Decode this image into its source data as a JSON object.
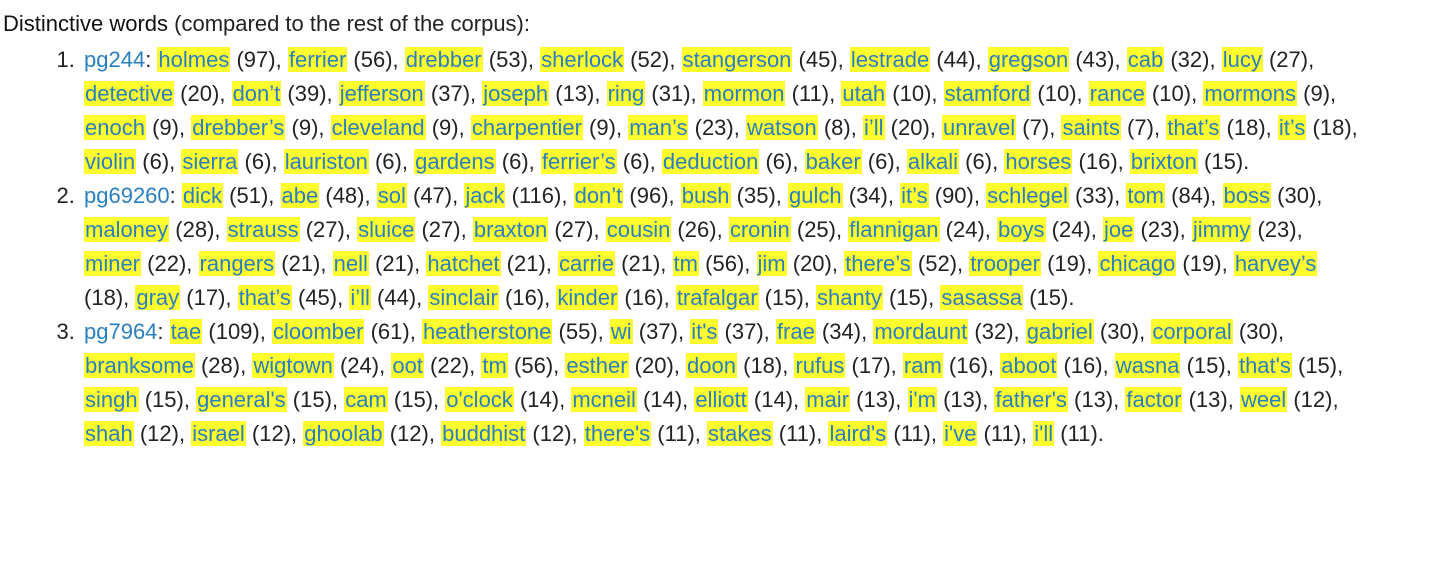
{
  "heading": {
    "main": "Distinctive words",
    "sub": " (compared to the rest of the corpus):"
  },
  "colors": {
    "highlight": "#ffff2e",
    "link": "#2a7fbf",
    "text": "#222222"
  },
  "documents": [
    {
      "id": "pg244",
      "words": [
        {
          "w": "holmes",
          "c": "97"
        },
        {
          "w": "ferrier",
          "c": "56"
        },
        {
          "w": "drebber",
          "c": "53"
        },
        {
          "w": "sherlock",
          "c": "52"
        },
        {
          "w": "stangerson",
          "c": "45"
        },
        {
          "w": "lestrade",
          "c": "44"
        },
        {
          "w": "gregson",
          "c": "43"
        },
        {
          "w": "cab",
          "c": "32"
        },
        {
          "w": "lucy",
          "c": "27"
        },
        {
          "w": "detective",
          "c": "20"
        },
        {
          "w": "don’t",
          "c": "39"
        },
        {
          "w": "jefferson",
          "c": "37"
        },
        {
          "w": "joseph",
          "c": "13"
        },
        {
          "w": "ring",
          "c": "31"
        },
        {
          "w": "mormon",
          "c": "11"
        },
        {
          "w": "utah",
          "c": "10"
        },
        {
          "w": "stamford",
          "c": "10"
        },
        {
          "w": "rance",
          "c": "10"
        },
        {
          "w": "mormons",
          "c": "9"
        },
        {
          "w": "enoch",
          "c": "9"
        },
        {
          "w": "drebber’s",
          "c": "9"
        },
        {
          "w": "cleveland",
          "c": "9"
        },
        {
          "w": "charpentier",
          "c": "9"
        },
        {
          "w": "man’s",
          "c": "23"
        },
        {
          "w": "watson",
          "c": "8"
        },
        {
          "w": "i’ll",
          "c": "20"
        },
        {
          "w": "unravel",
          "c": "7"
        },
        {
          "w": "saints",
          "c": "7"
        },
        {
          "w": "that’s",
          "c": "18"
        },
        {
          "w": "it’s",
          "c": "18"
        },
        {
          "w": "violin",
          "c": "6"
        },
        {
          "w": "sierra",
          "c": "6"
        },
        {
          "w": "lauriston",
          "c": "6"
        },
        {
          "w": "gardens",
          "c": "6"
        },
        {
          "w": "ferrier’s",
          "c": "6"
        },
        {
          "w": "deduction",
          "c": "6"
        },
        {
          "w": "baker",
          "c": "6"
        },
        {
          "w": "alkali",
          "c": "6"
        },
        {
          "w": "horses",
          "c": "16"
        },
        {
          "w": "brixton",
          "c": "15"
        }
      ]
    },
    {
      "id": "pg69260",
      "words": [
        {
          "w": "dick",
          "c": "51"
        },
        {
          "w": "abe",
          "c": "48"
        },
        {
          "w": "sol",
          "c": "47"
        },
        {
          "w": "jack",
          "c": "116"
        },
        {
          "w": "don’t",
          "c": "96"
        },
        {
          "w": "bush",
          "c": "35"
        },
        {
          "w": "gulch",
          "c": "34"
        },
        {
          "w": "it’s",
          "c": "90"
        },
        {
          "w": "schlegel",
          "c": "33"
        },
        {
          "w": "tom",
          "c": "84"
        },
        {
          "w": "boss",
          "c": "30"
        },
        {
          "w": "maloney",
          "c": "28"
        },
        {
          "w": "strauss",
          "c": "27"
        },
        {
          "w": "sluice",
          "c": "27"
        },
        {
          "w": "braxton",
          "c": "27"
        },
        {
          "w": "cousin",
          "c": "26"
        },
        {
          "w": "cronin",
          "c": "25"
        },
        {
          "w": "flannigan",
          "c": "24"
        },
        {
          "w": "boys",
          "c": "24"
        },
        {
          "w": "joe",
          "c": "23"
        },
        {
          "w": "jimmy",
          "c": "23"
        },
        {
          "w": "miner",
          "c": "22"
        },
        {
          "w": "rangers",
          "c": "21"
        },
        {
          "w": "nell",
          "c": "21"
        },
        {
          "w": "hatchet",
          "c": "21"
        },
        {
          "w": "carrie",
          "c": "21"
        },
        {
          "w": "tm",
          "c": "56"
        },
        {
          "w": "jim",
          "c": "20"
        },
        {
          "w": "there’s",
          "c": "52"
        },
        {
          "w": "trooper",
          "c": "19"
        },
        {
          "w": "chicago",
          "c": "19"
        },
        {
          "w": "harvey’s",
          "c": "18"
        },
        {
          "w": "gray",
          "c": "17"
        },
        {
          "w": "that’s",
          "c": "45"
        },
        {
          "w": "i’ll",
          "c": "44"
        },
        {
          "w": "sinclair",
          "c": "16"
        },
        {
          "w": "kinder",
          "c": "16"
        },
        {
          "w": "trafalgar",
          "c": "15"
        },
        {
          "w": "shanty",
          "c": "15"
        },
        {
          "w": "sasassa",
          "c": "15"
        }
      ]
    },
    {
      "id": "pg7964",
      "words": [
        {
          "w": "tae",
          "c": "109"
        },
        {
          "w": "cloomber",
          "c": "61"
        },
        {
          "w": "heatherstone",
          "c": "55"
        },
        {
          "w": "wi",
          "c": "37"
        },
        {
          "w": "it's",
          "c": "37"
        },
        {
          "w": "frae",
          "c": "34"
        },
        {
          "w": "mordaunt",
          "c": "32"
        },
        {
          "w": "gabriel",
          "c": "30"
        },
        {
          "w": "corporal",
          "c": "30"
        },
        {
          "w": "branksome",
          "c": "28"
        },
        {
          "w": "wigtown",
          "c": "24"
        },
        {
          "w": "oot",
          "c": "22"
        },
        {
          "w": "tm",
          "c": "56"
        },
        {
          "w": "esther",
          "c": "20"
        },
        {
          "w": "doon",
          "c": "18"
        },
        {
          "w": "rufus",
          "c": "17"
        },
        {
          "w": "ram",
          "c": "16"
        },
        {
          "w": "aboot",
          "c": "16"
        },
        {
          "w": "wasna",
          "c": "15"
        },
        {
          "w": "that's",
          "c": "15"
        },
        {
          "w": "singh",
          "c": "15"
        },
        {
          "w": "general's",
          "c": "15"
        },
        {
          "w": "cam",
          "c": "15"
        },
        {
          "w": "o'clock",
          "c": "14"
        },
        {
          "w": "mcneil",
          "c": "14"
        },
        {
          "w": "elliott",
          "c": "14"
        },
        {
          "w": "mair",
          "c": "13"
        },
        {
          "w": "i'm",
          "c": "13"
        },
        {
          "w": "father's",
          "c": "13"
        },
        {
          "w": "factor",
          "c": "13"
        },
        {
          "w": "weel",
          "c": "12"
        },
        {
          "w": "shah",
          "c": "12"
        },
        {
          "w": "israel",
          "c": "12"
        },
        {
          "w": "ghoolab",
          "c": "12"
        },
        {
          "w": "buddhist",
          "c": "12"
        },
        {
          "w": "there's",
          "c": "11"
        },
        {
          "w": "stakes",
          "c": "11"
        },
        {
          "w": "laird's",
          "c": "11"
        },
        {
          "w": "i've",
          "c": "11"
        },
        {
          "w": "i'll",
          "c": "11"
        }
      ]
    }
  ]
}
